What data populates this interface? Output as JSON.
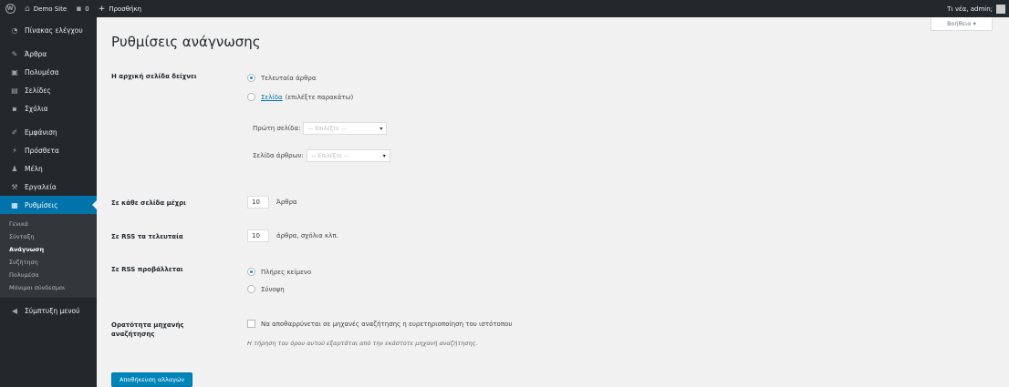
{
  "adminbar": {
    "site_name": "Demo Site",
    "comments_count": "0",
    "new_label": "Προσθήκη",
    "greeting": "Τι νέα, admin;"
  },
  "help_tab": {
    "label": "Βοήθεια ▾"
  },
  "sidebar": {
    "items": [
      {
        "icon": "dashboard-icon",
        "label": "Πίνακας ελέγχου"
      },
      {
        "icon": "posts-icon",
        "label": "Άρθρα"
      },
      {
        "icon": "media-icon",
        "label": "Πολυμέσα"
      },
      {
        "icon": "pages-icon",
        "label": "Σελίδες"
      },
      {
        "icon": "comments-icon",
        "label": "Σχόλια"
      },
      {
        "icon": "appearance-icon",
        "label": "Εμφάνιση"
      },
      {
        "icon": "plugins-icon",
        "label": "Πρόσθετα"
      },
      {
        "icon": "users-icon",
        "label": "Μέλη"
      },
      {
        "icon": "tools-icon",
        "label": "Εργαλεία"
      },
      {
        "icon": "settings-icon",
        "label": "Ρυθμίσεις"
      },
      {
        "icon": "collapse-icon",
        "label": "Σύμπτυξη μενού"
      }
    ],
    "submenu": [
      "Γενικά",
      "Σύνταξη",
      "Ανάγνωση",
      "Συζήτηση",
      "Πολυμέσα",
      "Μόνιμοι σύνδεσμοι"
    ]
  },
  "page": {
    "title": "Ρυθμίσεις ανάγνωσης",
    "front_label": "Η αρχική σελίδα δείχνει",
    "front_opt_latest": "Τελευταία άρθρα",
    "front_opt_page_link": "Σελίδα",
    "front_opt_page_suffix": "(επιλέξτε παρακάτω)",
    "front_page_label": "Πρώτη σελίδα:",
    "posts_page_label": "Σελίδα άρθρων:",
    "select_placeholder": "— Επιλέξτε —",
    "per_page_label": "Σε κάθε σελίδα μέχρι",
    "per_page_value": "10",
    "per_page_unit": "Άρθρα",
    "rss_label": "Σε RSS τα τελευταία",
    "rss_value": "10",
    "rss_unit": "άρθρα, σχόλια κλπ.",
    "rss_show_label": "Σε RSS προβάλλεται",
    "rss_opt_full": "Πλήρες κείμενο",
    "rss_opt_summary": "Σύνοψη",
    "search_label": "Ορατότητα μηχανής αναζήτησης",
    "search_checkbox": "Να αποθαρρύνεται σε μηχανές αναζήτησης η ευρετηριοποίηση του ιστότοπου",
    "search_desc": "Η τήρηση του όρου αυτού εξαρτάται από την εκάστοτε μηχανή αναζήτησης.",
    "save_label": "Αποθήκευση αλλαγών"
  },
  "colors": {
    "accent": "#0073aa",
    "adminbar": "#23282d",
    "background": "#f1f1f1"
  }
}
